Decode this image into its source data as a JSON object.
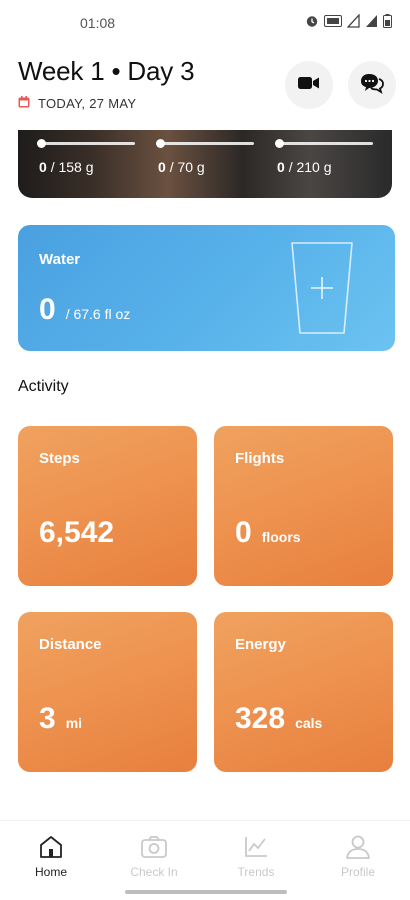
{
  "status": {
    "time": "01:08",
    "icons": [
      "alarm-icon",
      "volte-icon",
      "signal-icon",
      "signal-icon",
      "battery-icon"
    ]
  },
  "header": {
    "title": "Week 1 • Day 3",
    "date": "TODAY, 27 MAY",
    "date_icon": "calendar-icon",
    "video_icon": "video-camera-icon",
    "chat_icon": "chat-bubbles-icon"
  },
  "macros": [
    {
      "current": "0",
      "target": "/ 158 g"
    },
    {
      "current": "0",
      "target": "/ 70 g"
    },
    {
      "current": "0",
      "target": "/ 210 g"
    }
  ],
  "water": {
    "label": "Water",
    "current": "0",
    "target": "/ 67.6 fl oz",
    "add_icon": "plus-icon"
  },
  "activity": {
    "title": "Activity",
    "tiles": [
      {
        "label": "Steps",
        "value": "6,542",
        "unit": ""
      },
      {
        "label": "Flights",
        "value": "0",
        "unit": "floors"
      },
      {
        "label": "Distance",
        "value": "3",
        "unit": "mi"
      },
      {
        "label": "Energy",
        "value": "328",
        "unit": "cals"
      }
    ]
  },
  "nav": {
    "items": [
      {
        "label": "Home",
        "icon": "home-icon",
        "active": true
      },
      {
        "label": "Check In",
        "icon": "camera-icon",
        "active": false
      },
      {
        "label": "Trends",
        "icon": "trend-chart-icon",
        "active": false
      },
      {
        "label": "Profile",
        "icon": "person-icon",
        "active": false
      }
    ]
  },
  "colors": {
    "water_card": "#58b2ea",
    "activity_tile": "#ee9350",
    "calendar_icon": "#e85a5a"
  }
}
